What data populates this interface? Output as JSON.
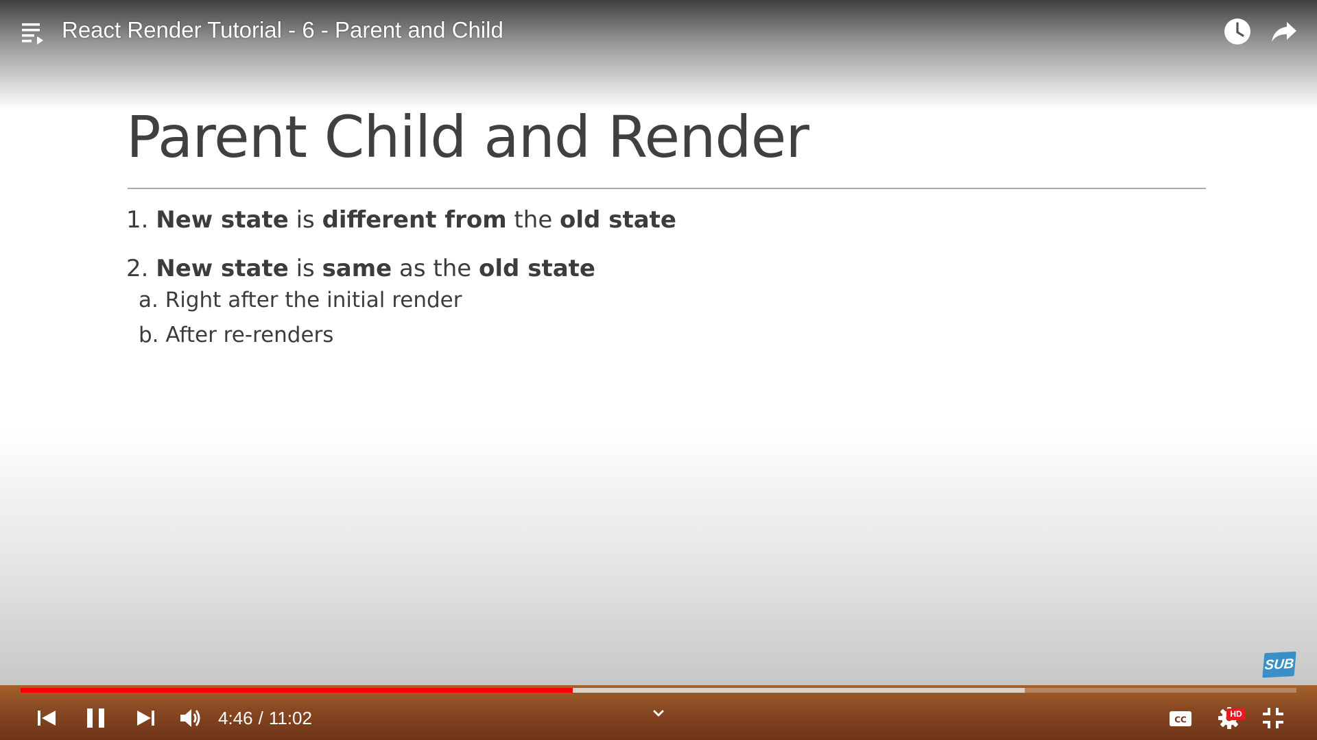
{
  "video": {
    "title": "React Render Tutorial - 6 - Parent and Child"
  },
  "slide": {
    "title": "Parent Child and Render",
    "items": [
      {
        "number": "1.",
        "parts": [
          {
            "text": "New state",
            "bold": true
          },
          {
            "text": " is ",
            "bold": false
          },
          {
            "text": "different from",
            "bold": true
          },
          {
            "text": " the ",
            "bold": false
          },
          {
            "text": "old state",
            "bold": true
          }
        ]
      },
      {
        "number": "2.",
        "parts": [
          {
            "text": "New state",
            "bold": true
          },
          {
            "text": " is ",
            "bold": false
          },
          {
            "text": "same",
            "bold": true
          },
          {
            "text": " as the ",
            "bold": false
          },
          {
            "text": "old state",
            "bold": true
          }
        ],
        "subitems": [
          "a. Right after the initial render",
          "b. After re-renders"
        ]
      }
    ]
  },
  "badge": {
    "sub_label": "SUB"
  },
  "controls": {
    "current_time": "4:46",
    "separator": "/",
    "duration": "11:02",
    "hd_label": "HD",
    "progress_played": 0.4328,
    "progress_buffered": 0.7871,
    "icons": {
      "playlist": "playlist-icon",
      "watch_later": "clock-icon",
      "share": "share-icon",
      "previous": "skip-previous-icon",
      "pause": "pause-icon",
      "next": "skip-next-icon",
      "volume": "volume-icon",
      "expand": "chevron-down-icon",
      "captions": "cc-icon",
      "settings": "gear-icon",
      "exit_fullscreen": "exit-fullscreen-icon"
    }
  },
  "colors": {
    "played": "#ff0000",
    "control_bar": "#8a4a22",
    "sub_badge": "#3b8fc8",
    "hd_badge": "#e31b23"
  }
}
